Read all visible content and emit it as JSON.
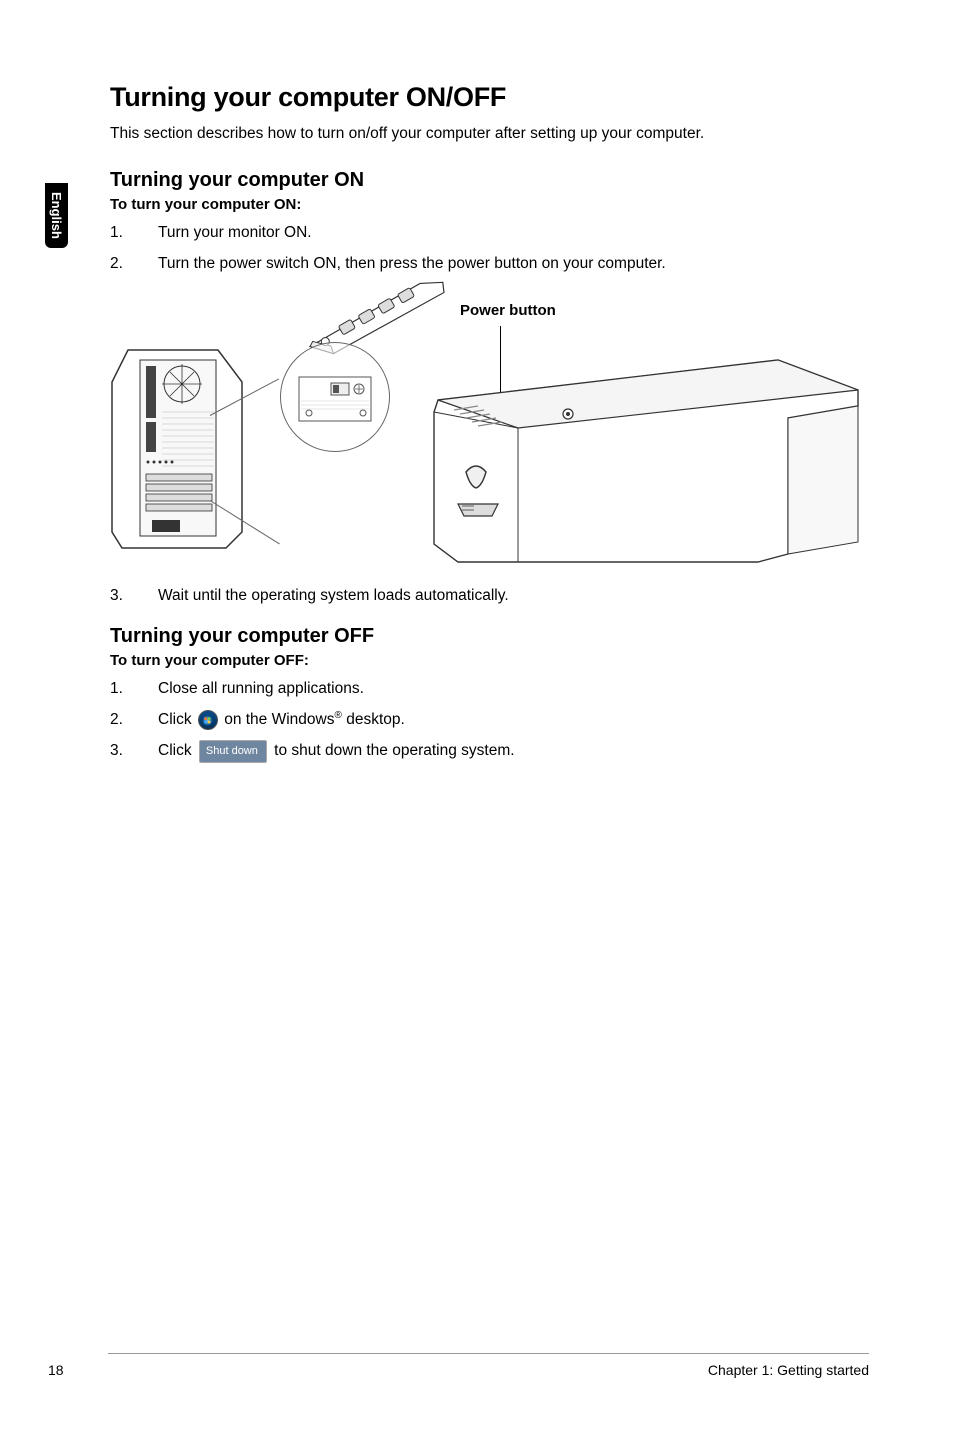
{
  "side_tab": "English",
  "title": "Turning your computer ON/OFF",
  "intro": "This section describes how to turn on/off your computer after setting up your computer.",
  "section_on": {
    "heading": "Turning your computer ON",
    "sub": "To turn your computer ON:",
    "steps": [
      {
        "n": "1.",
        "text": "Turn your monitor ON."
      },
      {
        "n": "2.",
        "text": "Turn the power switch ON, then press the power button on your computer."
      }
    ],
    "figure_label": "Power button",
    "step3": {
      "n": "3.",
      "text": "Wait until the operating system loads automatically."
    }
  },
  "section_off": {
    "heading": "Turning your computer OFF",
    "sub": "To turn your computer OFF:",
    "steps": [
      {
        "n": "1.",
        "text": "Close all running applications."
      },
      {
        "n": "2.",
        "pre": "Click ",
        "post_a": " on the Windows",
        "reg": "®",
        "post_b": " desktop."
      },
      {
        "n": "3.",
        "pre": "Click ",
        "btn": "Shut down",
        "post": " to shut down the operating system."
      }
    ]
  },
  "footer": {
    "page": "18",
    "chapter": "Chapter 1: Getting started"
  }
}
